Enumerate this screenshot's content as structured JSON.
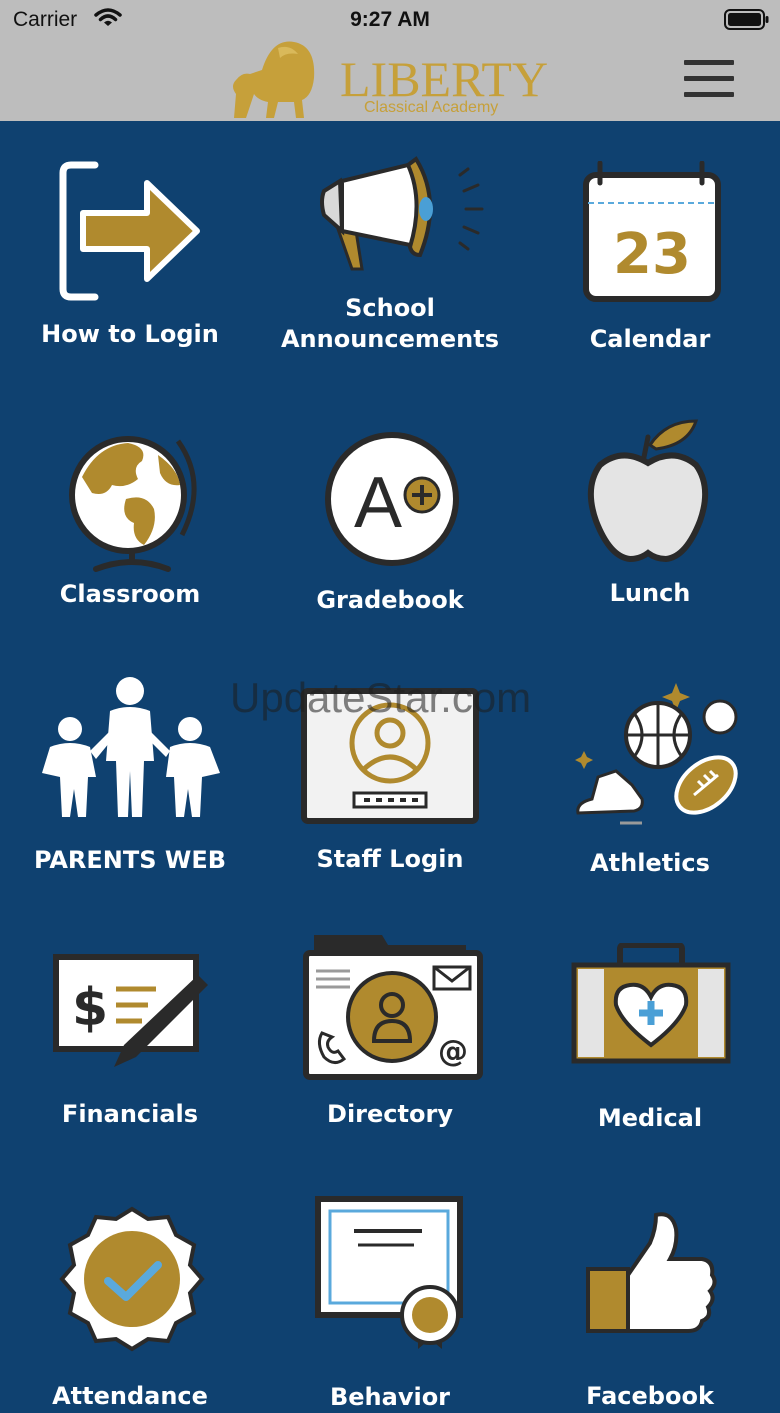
{
  "status_bar": {
    "carrier": "Carrier",
    "time": "9:27 AM"
  },
  "header": {
    "logo_name": "LIBERTY",
    "logo_subtitle": "Classical Academy",
    "menu_icon": "hamburger-menu-icon"
  },
  "colors": {
    "background": "#0f4170",
    "header": "#bdbdbd",
    "gold": "#b08a2e",
    "white": "#ffffff"
  },
  "tiles": [
    {
      "label": "How to Login",
      "icon": "login-arrow-icon"
    },
    {
      "label": "School\nAnnouncements",
      "icon": "megaphone-icon"
    },
    {
      "label": "Calendar",
      "icon": "calendar-icon",
      "calendar_day": "23"
    },
    {
      "label": "Classroom",
      "icon": "globe-icon"
    },
    {
      "label": "Gradebook",
      "icon": "grade-a-plus-icon",
      "grade": "A"
    },
    {
      "label": "Lunch",
      "icon": "apple-icon"
    },
    {
      "label": "PARENTS WEB",
      "icon": "family-icon"
    },
    {
      "label": "Staff Login",
      "icon": "staff-badge-icon"
    },
    {
      "label": "Athletics",
      "icon": "sports-balls-icon"
    },
    {
      "label": "Financials",
      "icon": "check-pen-icon"
    },
    {
      "label": "Directory",
      "icon": "contact-card-icon"
    },
    {
      "label": "Medical",
      "icon": "medical-kit-icon"
    },
    {
      "label": "Attendance",
      "icon": "checkmark-badge-icon"
    },
    {
      "label": "Behavior",
      "icon": "certificate-icon"
    },
    {
      "label": "Facebook",
      "icon": "thumbs-up-icon"
    }
  ],
  "watermark": "UpdateStar.com"
}
